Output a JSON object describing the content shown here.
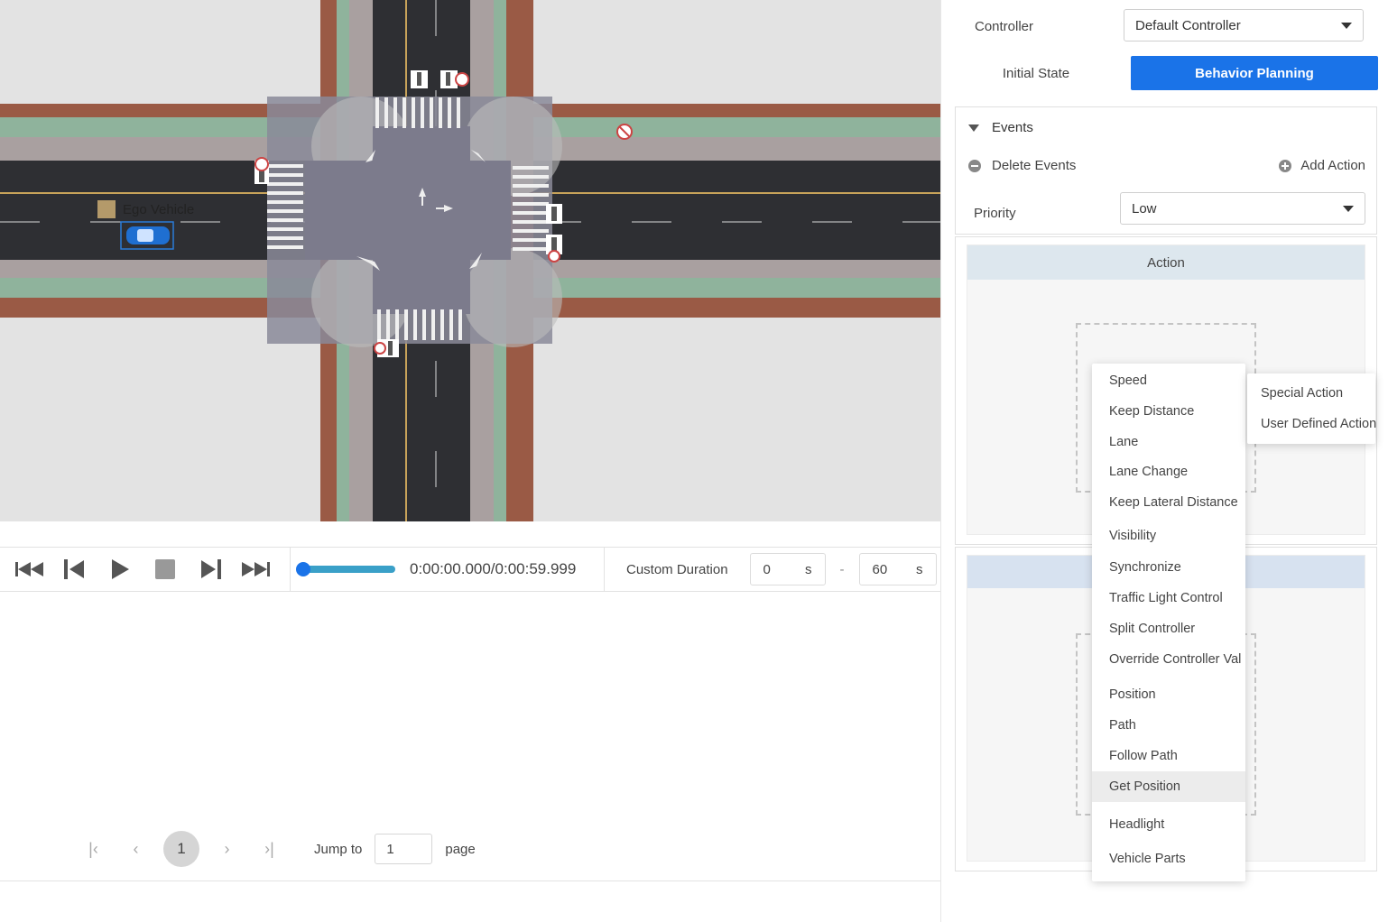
{
  "map": {
    "ego_label": "Ego Vehicle"
  },
  "playback": {
    "time": "0:00:00.000/0:00:59.999",
    "progress_fraction": 0.0,
    "custom_duration_label": "Custom Duration",
    "start_value": "0",
    "start_unit": "s",
    "separator": "-",
    "end_value": "60",
    "end_unit": "s"
  },
  "pagination": {
    "current_page": "1",
    "jump_label": "Jump to",
    "jump_value": "1",
    "page_label": "page"
  },
  "panel": {
    "controller_label": "Controller",
    "controller_value": "Default Controller",
    "tab_initial": "Initial State",
    "tab_behavior": "Behavior Planning",
    "events_label": "Events",
    "delete_events": "Delete Events",
    "add_action": "Add Action",
    "priority_label": "Priority",
    "priority_value": "Low",
    "action_header": "Action"
  },
  "menu": {
    "items": [
      "Speed",
      "Keep Distance",
      "Lane",
      "Lane Change",
      "Keep Lateral Distance",
      "Visibility",
      "Synchronize",
      "Traffic Light Control",
      "Split Controller",
      "Override Controller Val",
      "Position",
      "Path",
      "Follow Path",
      "Get Position",
      "Headlight",
      "Vehicle Parts"
    ],
    "hovered": "Get Position",
    "submenu": [
      "Special Action",
      "User Defined Action"
    ]
  },
  "colors": {
    "accent": "#1a73e8",
    "road": "#2e2f33",
    "sidewalk": "#a9a0a0",
    "curb_brown": "#9a5a45",
    "grass": "#8fb39c",
    "intersection": "#7c7b8c"
  }
}
